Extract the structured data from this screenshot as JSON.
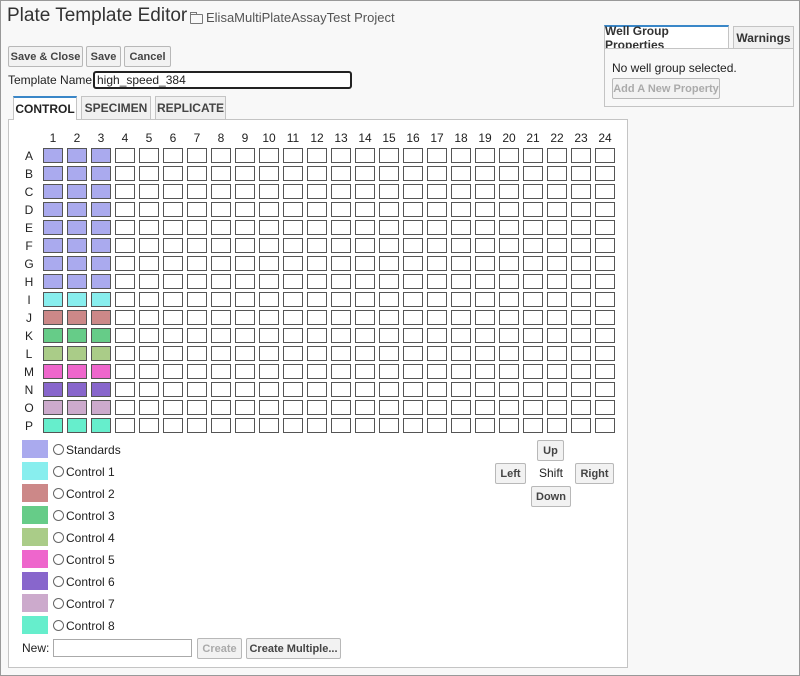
{
  "header": {
    "title": "Plate Template Editor",
    "project": "ElisaMultiPlateAssayTest Project"
  },
  "toolbar": {
    "save_close": "Save & Close",
    "save": "Save",
    "cancel": "Cancel"
  },
  "template": {
    "label": "Template Name:",
    "value": "high_speed_384"
  },
  "tabs": [
    "CONTROL",
    "SPECIMEN",
    "REPLICATE"
  ],
  "plate": {
    "columns": [
      "1",
      "2",
      "3",
      "4",
      "5",
      "6",
      "7",
      "8",
      "9",
      "10",
      "11",
      "12",
      "13",
      "14",
      "15",
      "16",
      "17",
      "18",
      "19",
      "20",
      "21",
      "22",
      "23",
      "24"
    ],
    "rows": [
      "A",
      "B",
      "C",
      "D",
      "E",
      "F",
      "G",
      "H",
      "I",
      "J",
      "K",
      "L",
      "M",
      "N",
      "O",
      "P"
    ],
    "filled_columns": 3
  },
  "groups": [
    {
      "name": "Standards",
      "color": "#aaaaee"
    },
    {
      "name": "Control 1",
      "color": "#88eeee"
    },
    {
      "name": "Control 2",
      "color": "#cc8888"
    },
    {
      "name": "Control 3",
      "color": "#66cc88"
    },
    {
      "name": "Control 4",
      "color": "#aacc88"
    },
    {
      "name": "Control 5",
      "color": "#ee66cc"
    },
    {
      "name": "Control 6",
      "color": "#8866cc"
    },
    {
      "name": "Control 7",
      "color": "#ccaacc"
    },
    {
      "name": "Control 8",
      "color": "#66eecc"
    }
  ],
  "row_groups": [
    0,
    0,
    0,
    0,
    0,
    0,
    0,
    0,
    1,
    2,
    3,
    4,
    5,
    6,
    7,
    8
  ],
  "shift": {
    "label": "Shift",
    "up": "Up",
    "down": "Down",
    "left": "Left",
    "right": "Right"
  },
  "new_group": {
    "label": "New:",
    "value": "",
    "create": "Create",
    "create_multiple": "Create Multiple..."
  },
  "side_panel": {
    "tabs": [
      "Well Group Properties",
      "Warnings"
    ],
    "message": "No well group selected.",
    "add_property": "Add A New Property"
  }
}
